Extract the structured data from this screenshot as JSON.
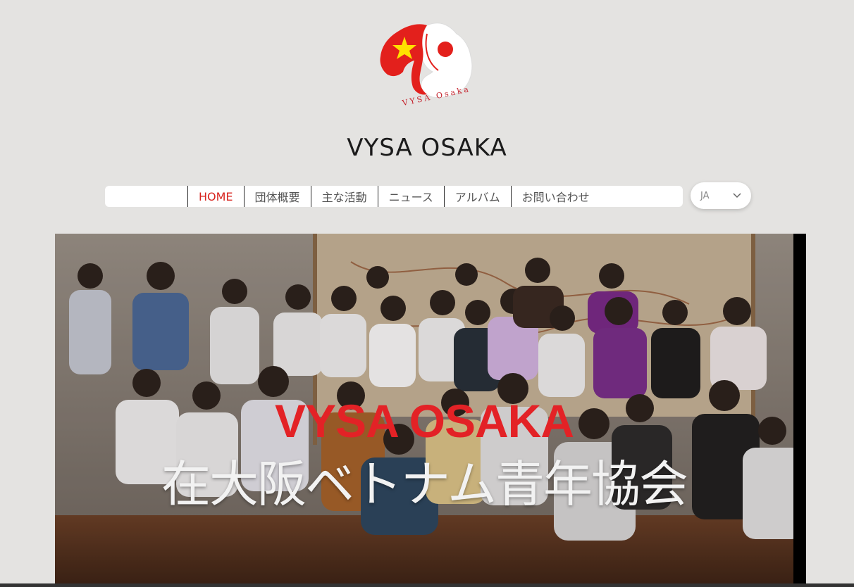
{
  "site": {
    "logo_text": "VYSA Osaka",
    "title": "VYSA OSAKA"
  },
  "nav": {
    "items": [
      {
        "label": "HOME",
        "active": true
      },
      {
        "label": "団体概要"
      },
      {
        "label": "主な活動"
      },
      {
        "label": "ニュース"
      },
      {
        "label": "アルバム"
      },
      {
        "label": "お問い合わせ"
      }
    ]
  },
  "language": {
    "selected": "JA",
    "icon": "chevron-down-icon"
  },
  "hero": {
    "title": "VYSA OSAKA",
    "subtitle": "在大阪ベトナム青年協会"
  },
  "colors": {
    "accent": "#d8251f",
    "background": "#e4e3e1",
    "flag_star": "#ffe000"
  }
}
